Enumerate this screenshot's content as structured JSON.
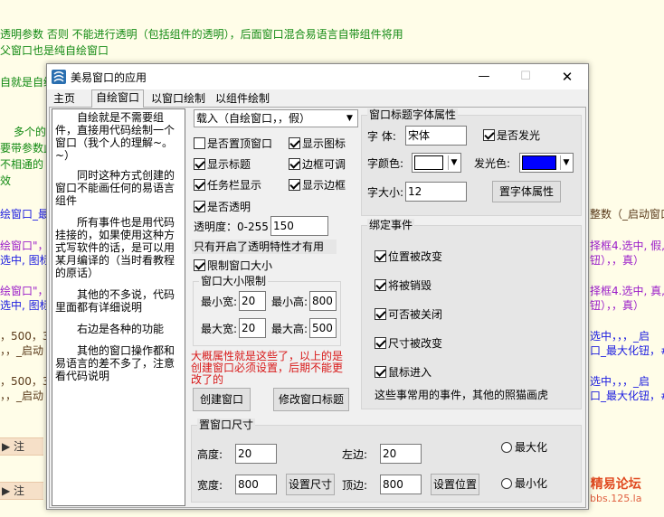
{
  "background": {
    "lines": [
      "透明参数 否则 不能进行透明（包括组件的透明），后面窗口混合易语言自带组件将用",
      "父窗口也是纯自绘窗口",
      "自就是自绘",
      "多个的",
      "要带参数此",
      "不相通的",
      "效",
      "绘窗口_最",
      "绘窗口\"，",
      "选中, 图标",
      "绘窗口\"，",
      "选中, 图标",
      "，500，3",
      "，，_启动",
      "，500，3",
      "，，_启动",
      "整数（_启动窗口",
      "择框4.选中, 假,",
      "钮），，真）",
      "择框4.选中, 真,",
      "钮），，真）",
      "选中，，，_启",
      "口_最大化钮，#窗",
      "选中，，，_启",
      "口_最大化钮，#窗"
    ],
    "note_bar_1": "▶ 注",
    "note_bar_2": "▶ 注",
    "watermark_title": "精易论坛",
    "watermark_url": "bbs.125.la",
    "colors": {
      "green": "#138a13",
      "purple": "#9b1dc9",
      "blue": "#1a1ae0",
      "note_bar": "#f6e0c8"
    }
  },
  "window": {
    "title": "美易窗口的应用",
    "icon": "app-logo-icon",
    "minimize": "—",
    "maximize": "☐",
    "close": "✕"
  },
  "tabs": [
    "主页",
    "自绘窗口",
    "以窗口绘制",
    "以组件绘制"
  ],
  "active_tab": 1,
  "memo": [
    "自绘就是不需要组件，直接用代码绘制一个窗口（我个人的理解~。~）",
    "同时这种方式创建的窗口不能画任何的易语言组件",
    "所有事件也是用代码挂接的，如果使用这种方式写软件的话，是可以用某月编译的（当时看教程的原话）",
    "其他的不多说，代码里面都有详细说明",
    "右边是各种的功能",
    "其他的窗口操作都和易语言的差不多了，注意看代码说明"
  ],
  "create_mode_combo": "载入（自绘窗口，，假）",
  "checkboxes": [
    {
      "label": "是否置顶窗口",
      "checked": false
    },
    {
      "label": "显示图标",
      "checked": true
    },
    {
      "label": "显示标题",
      "checked": true
    },
    {
      "label": "边框可调",
      "checked": true
    },
    {
      "label": "任务栏显示",
      "checked": true
    },
    {
      "label": "显示边框",
      "checked": true
    },
    {
      "label": "是否透明",
      "checked": true
    }
  ],
  "transparency": {
    "label": "透明度：0-255",
    "value": "150",
    "note": "只有开启了透明特性才有用"
  },
  "limit_size": {
    "label": "限制窗口大小",
    "checked": true
  },
  "size_limit_group": {
    "title": "窗口大小限制",
    "min_w_label": "最小宽:",
    "min_w": "20",
    "min_h_label": "最小高:",
    "min_h": "800",
    "max_w_label": "最大宽:",
    "max_w": "20",
    "max_h_label": "最大高:",
    "max_h": "500"
  },
  "warning": "大概属性就是这些了，以上的是创建窗口必须设置，后期不能更改了的",
  "create_button": "创建窗口",
  "modify_title_button": "修改窗口标题",
  "font_group": {
    "title": "窗口标题字体属性",
    "font_label": "字 体:",
    "font_value": "宋体",
    "glow_label": "是否发光",
    "glow_checked": true,
    "color_label": "字颜色:",
    "color_value": "#ffffff",
    "glow_color_label": "发光色:",
    "glow_color_value": "#0000ff",
    "size_label": "字大小:",
    "size_value": "12",
    "set_button": "置字体属性"
  },
  "events_group": {
    "title": "绑定事件",
    "items": [
      {
        "label": "位置被改变",
        "checked": true
      },
      {
        "label": "将被销毁",
        "checked": true
      },
      {
        "label": "可否被关闭",
        "checked": true
      },
      {
        "label": "尺寸被改变",
        "checked": true
      },
      {
        "label": "鼠标进入",
        "checked": true
      }
    ],
    "note": "这些事常用的事件，其他的照猫画虎"
  },
  "size_group": {
    "title": "置窗口尺寸",
    "height_label": "高度:",
    "height": "20",
    "left_label": "左边:",
    "left": "20",
    "width_label": "宽度:",
    "width": "800",
    "top_label": "顶边:",
    "top": "800",
    "set_size_button": "设置尺寸",
    "set_pos_button": "设置位置",
    "maximize_label": "最大化",
    "minimize_label": "最小化"
  }
}
